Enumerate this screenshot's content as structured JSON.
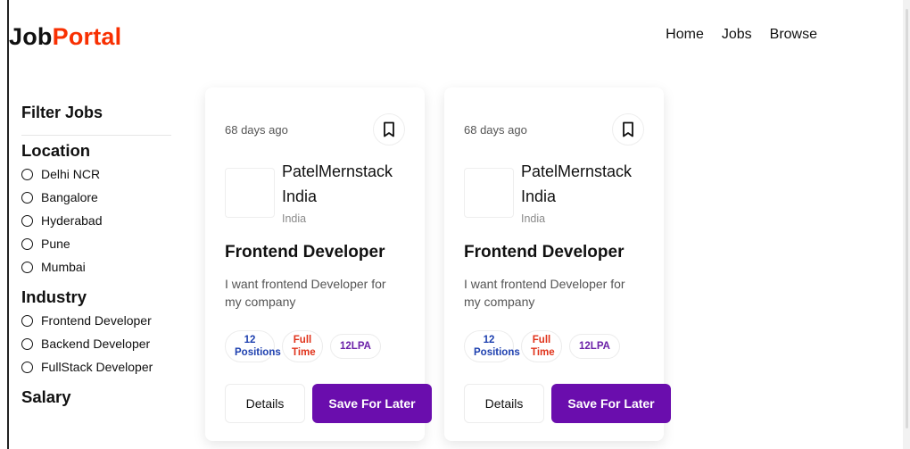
{
  "brand": {
    "part1": "Job",
    "part2": "Portal",
    "accent": "#f83002"
  },
  "nav": {
    "items": [
      "Home",
      "Jobs",
      "Browse"
    ]
  },
  "filters": {
    "title": "Filter Jobs",
    "groups": [
      {
        "title": "Location",
        "options": [
          "Delhi NCR",
          "Bangalore",
          "Hyderabad",
          "Pune",
          "Mumbai"
        ]
      },
      {
        "title": "Industry",
        "options": [
          "Frontend Developer",
          "Backend Developer",
          "FullStack Developer"
        ]
      },
      {
        "title": "Salary",
        "options": []
      }
    ]
  },
  "jobs": [
    {
      "posted": "68 days ago",
      "company": "PatelMernstack India",
      "location": "India",
      "title": "Frontend Developer",
      "description": "I want frontend Developer for my company",
      "positions_line1": "12",
      "positions_line2": "Positions",
      "jobtype_line1": "Full",
      "jobtype_line2": "Time",
      "salary": "12LPA",
      "details_label": "Details",
      "save_label": "Save For Later"
    },
    {
      "posted": "68 days ago",
      "company": "PatelMernstack India",
      "location": "India",
      "title": "Frontend Developer",
      "description": "I want frontend Developer for my company",
      "positions_line1": "12",
      "positions_line2": "Positions",
      "jobtype_line1": "Full",
      "jobtype_line2": "Time",
      "salary": "12LPA",
      "details_label": "Details",
      "save_label": "Save For Later"
    }
  ],
  "colors": {
    "save_button": "#6a0dad",
    "positions": "#1e40af",
    "jobtype": "#e0321a",
    "salary": "#6b21a8"
  },
  "icons": {
    "bookmark": "bookmark-icon",
    "radio": "radio-unchecked-icon"
  }
}
